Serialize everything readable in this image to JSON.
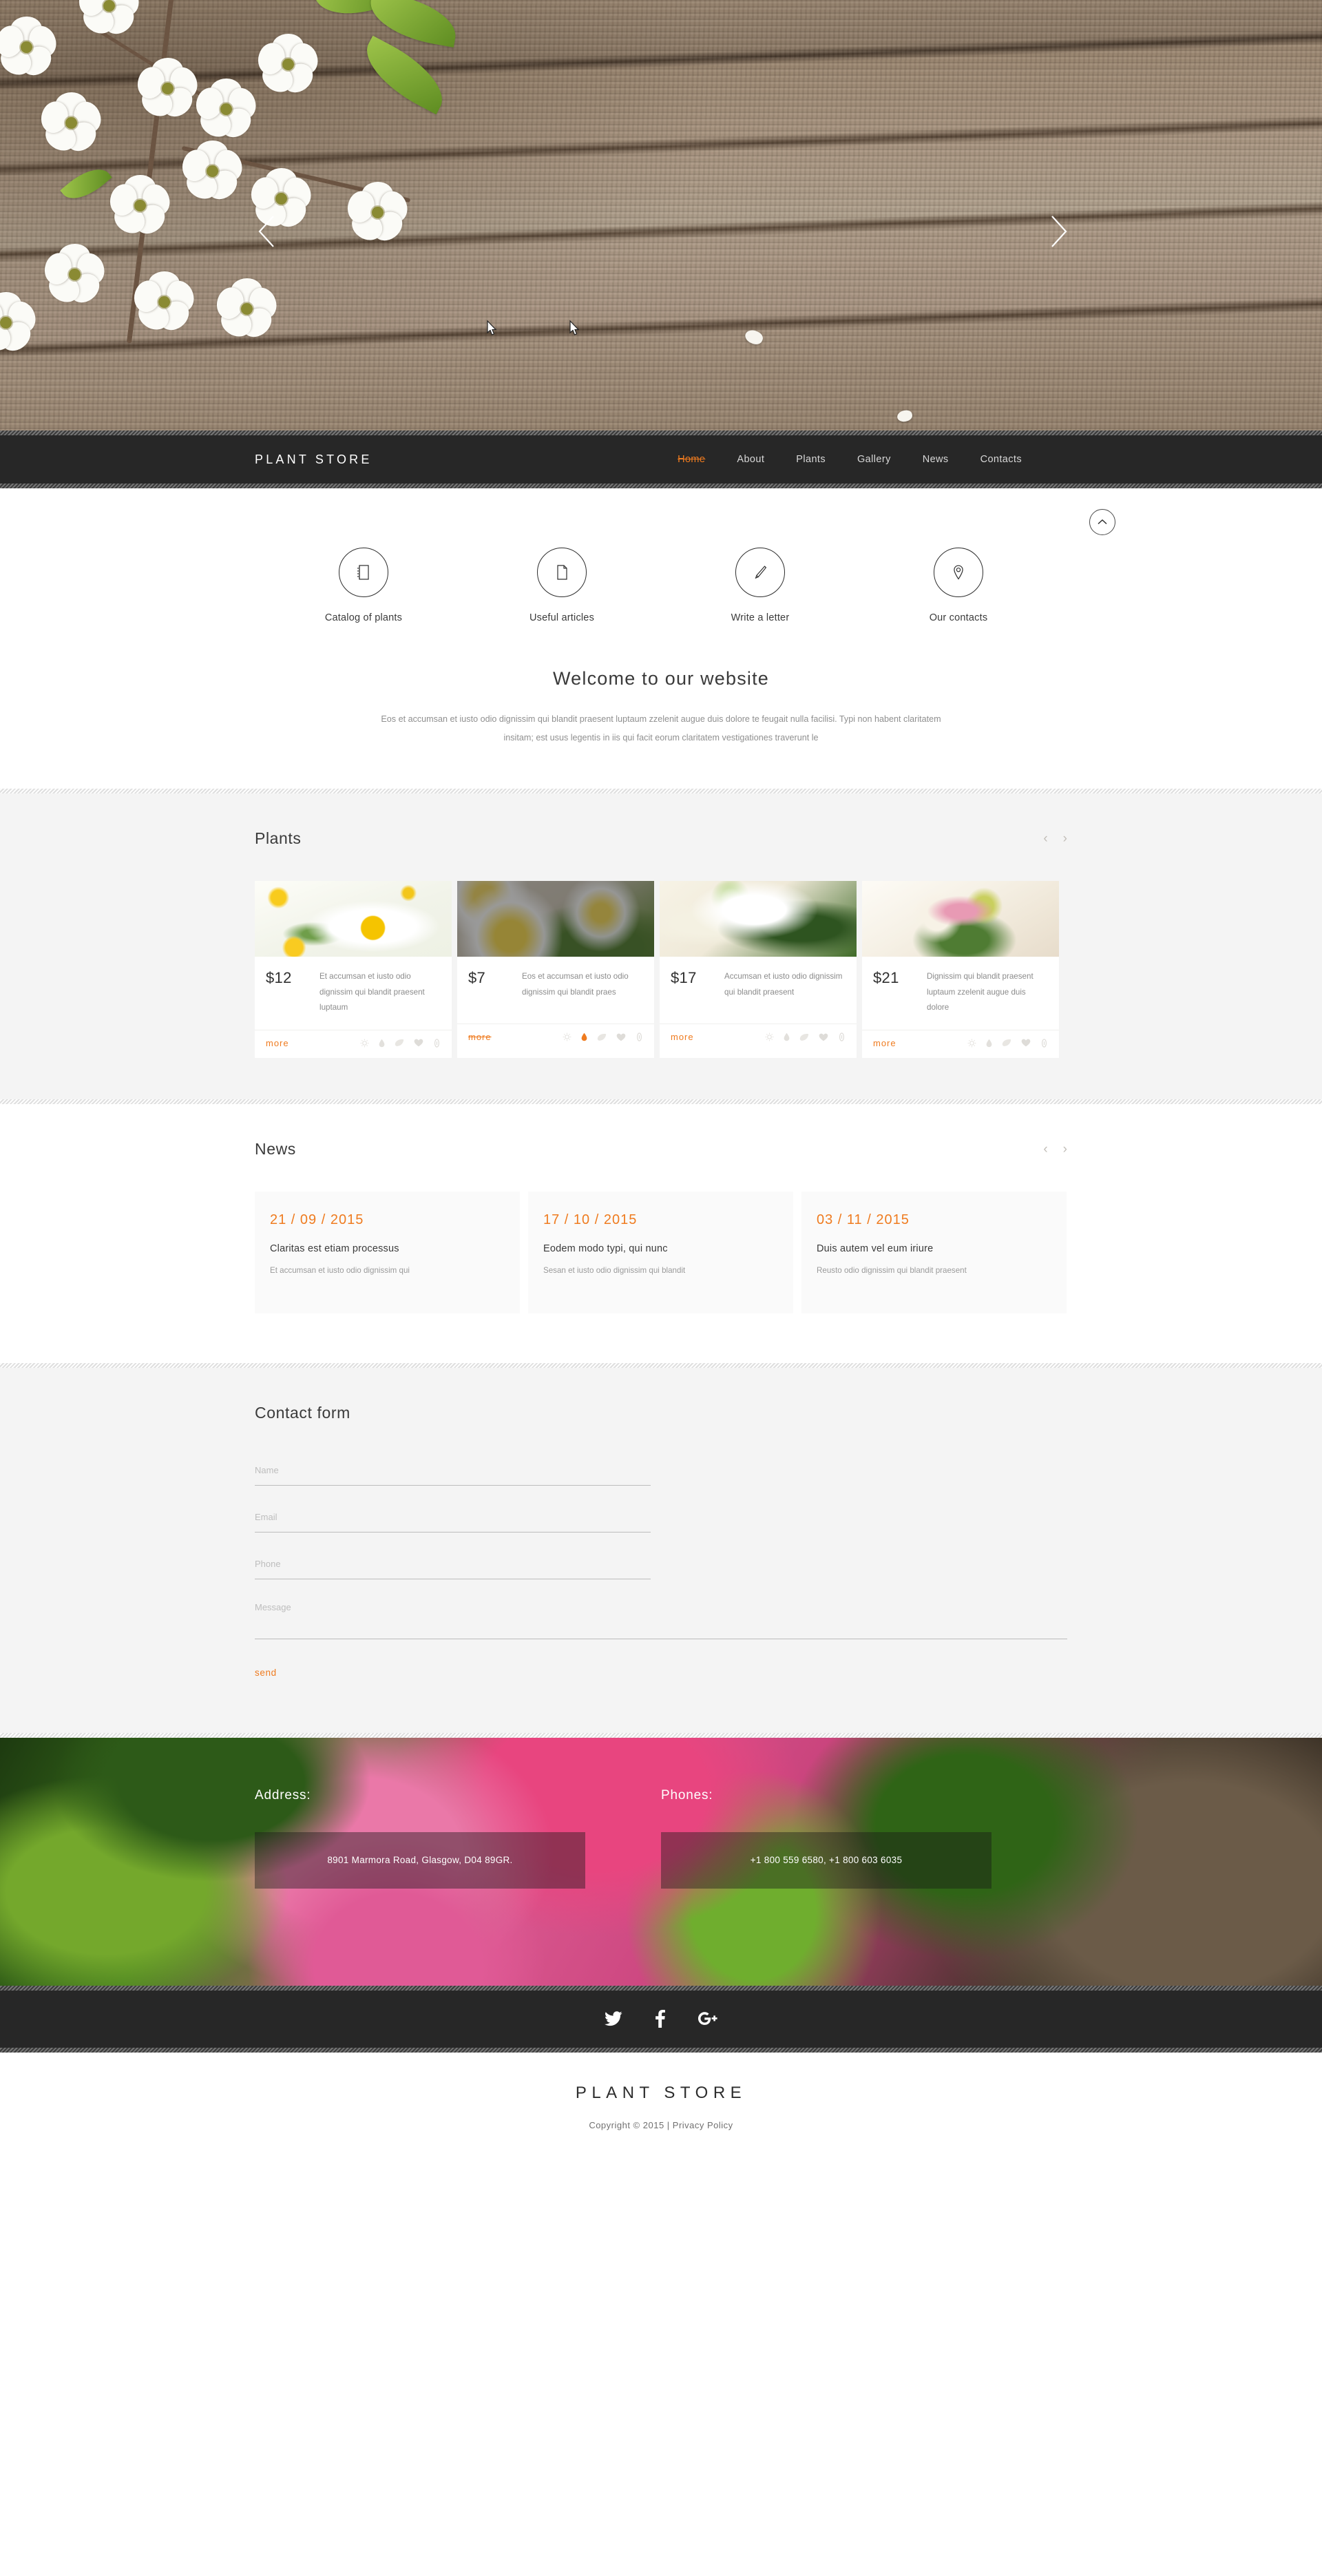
{
  "colors": {
    "accent": "#ef7b1f",
    "dark_bar": "#272727",
    "light_section": "#f4f4f4",
    "text_dark": "#3a3a3a",
    "text_muted": "#8f8f8f"
  },
  "hero": {
    "prev_label": "previous-slide",
    "next_label": "next-slide"
  },
  "nav": {
    "brand": "PLANT STORE",
    "items": [
      {
        "label": "Home",
        "active": true
      },
      {
        "label": "About",
        "active": false
      },
      {
        "label": "Plants",
        "active": false
      },
      {
        "label": "Gallery",
        "active": false
      },
      {
        "label": "News",
        "active": false
      },
      {
        "label": "Contacts",
        "active": false
      }
    ]
  },
  "scroll_top": {
    "icon": "chevron-up-icon"
  },
  "features": [
    {
      "icon": "book-icon",
      "label": "Catalog of plants"
    },
    {
      "icon": "document-icon",
      "label": "Useful articles"
    },
    {
      "icon": "pencil-icon",
      "label": "Write a letter"
    },
    {
      "icon": "map-pin-icon",
      "label": "Our contacts"
    }
  ],
  "welcome": {
    "title": "Welcome to our website",
    "line1": "Eos et accumsan et iusto odio dignissim qui blandit praesent luptaum zzelenit augue duis dolore te feugait nulla facilisi. Typi non habent claritatem",
    "line2": "insitam; est usus legentis in iis qui facit eorum claritatem vestigationes traverunt le"
  },
  "plants": {
    "title": "Plants",
    "prev": "‹",
    "next": "›",
    "more_label": "more",
    "card_icons": [
      "sun-icon",
      "water-drop-icon",
      "leaf-icon",
      "heart-icon",
      "info-icon"
    ],
    "items": [
      {
        "price": "$12",
        "desc": "Et accumsan et iusto odio dignissim qui blandit praesent luptaum",
        "image": "daisy",
        "hovered": false,
        "drop_active": false
      },
      {
        "price": "$7",
        "desc": "Eos et accumsan et iusto odio dignissim qui blandit praes",
        "image": "plumeria",
        "hovered": true,
        "drop_active": true
      },
      {
        "price": "$17",
        "desc": "Accumsan et iusto odio dignissim qui blandit praesent",
        "image": "bouquet",
        "hovered": false,
        "drop_active": false
      },
      {
        "price": "$21",
        "desc": "Dignissim qui blandit praesent luptaum zzelenit augue duis dolore",
        "image": "vase",
        "hovered": false,
        "drop_active": false
      }
    ]
  },
  "news": {
    "title": "News",
    "prev": "‹",
    "next": "›",
    "items": [
      {
        "date": "21 / 09 / 2015",
        "title": "Claritas est etiam processus",
        "excerpt": "Et accumsan et iusto odio dignissim qui"
      },
      {
        "date": "17 / 10 / 2015",
        "title": "Eodem modo typi, qui nunc",
        "excerpt": "Sesan et iusto odio dignissim qui blandit"
      },
      {
        "date": "03 / 11 / 2015",
        "title": "Duis autem vel eum iriure",
        "excerpt": "Reusto odio dignissim qui blandit praesent"
      }
    ]
  },
  "contact": {
    "title": "Contact form",
    "name_placeholder": "Name",
    "email_placeholder": "Email",
    "phone_placeholder": "Phone",
    "message_placeholder": "Message",
    "name_value": "",
    "email_value": "",
    "phone_value": "",
    "message_value": "",
    "send_label": "send"
  },
  "address": {
    "address_title": "Address:",
    "address_value": "8901 Marmora Road, Glasgow, D04 89GR.",
    "phones_title": "Phones:",
    "phones_value": "+1 800 559 6580, +1 800 603 6035"
  },
  "social": [
    {
      "icon": "twitter-icon",
      "name": "Twitter"
    },
    {
      "icon": "facebook-icon",
      "name": "Facebook"
    },
    {
      "icon": "google-plus-icon",
      "name": "Google Plus"
    }
  ],
  "footer": {
    "logo": "PLANT STORE",
    "copyright": "Copyright © 2015 | Privacy Policy"
  }
}
